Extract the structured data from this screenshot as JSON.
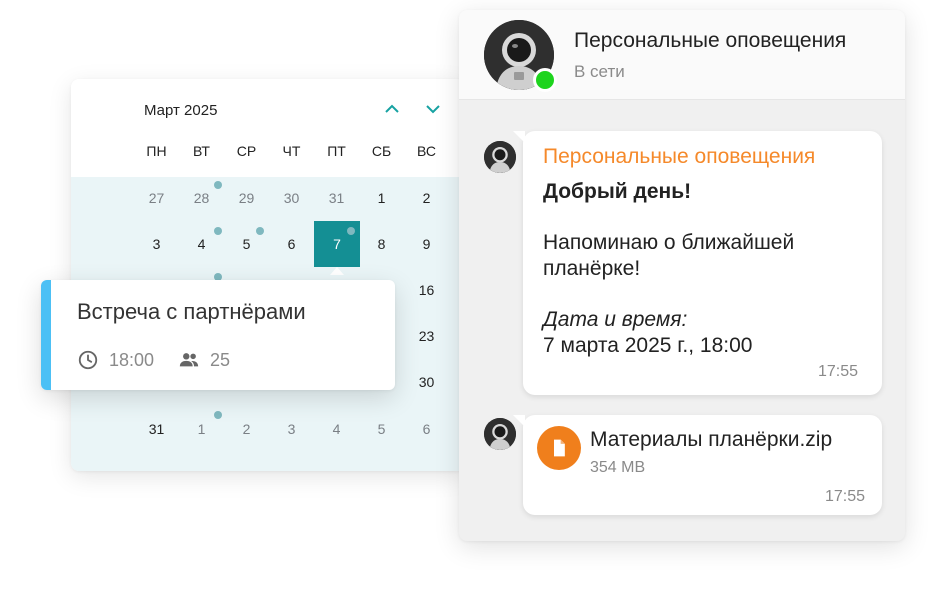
{
  "calendar": {
    "month": "Март 2025",
    "weekdays": [
      "ПН",
      "ВТ",
      "СР",
      "ЧТ",
      "ПТ",
      "СБ",
      "ВС"
    ],
    "visible_days": {
      "row1": [
        "27",
        "28",
        "29",
        "30",
        "31",
        "1",
        "2"
      ],
      "row2": [
        "3",
        "4",
        "5",
        "6",
        "7",
        "8",
        "9"
      ],
      "row3_sunday": "16",
      "row4_sunday": "23",
      "row5_sunday": "30",
      "row6": [
        "31",
        "1",
        "2",
        "3",
        "4",
        "5",
        "6"
      ]
    },
    "selected_day": "7",
    "colors": {
      "accent": "#148f94",
      "body_bg": "#eaf5f7",
      "event_dot": "#7fb8bf"
    }
  },
  "event": {
    "title": "Встреча с партнёрами",
    "time": "18:00",
    "participants": "25",
    "accent_color": "#4cc0f5"
  },
  "chat": {
    "name": "Персональные оповещения",
    "status": "В сети",
    "messages": [
      {
        "sender": "Персональные оповещения",
        "greeting": "Добрый день!",
        "text_line1": "Напоминаю о ближайшей",
        "text_line2": "планёрке!",
        "label": "Дата и время:",
        "datetime": "7 марта 2025 г., 18:00",
        "time": "17:55"
      },
      {
        "file_name": "Материалы планёрки.zip",
        "file_size": "354 MB",
        "time": "17:55"
      }
    ],
    "colors": {
      "sender": "#f5892a",
      "file_icon": "#f07f1c",
      "online": "#1ed41e"
    }
  }
}
